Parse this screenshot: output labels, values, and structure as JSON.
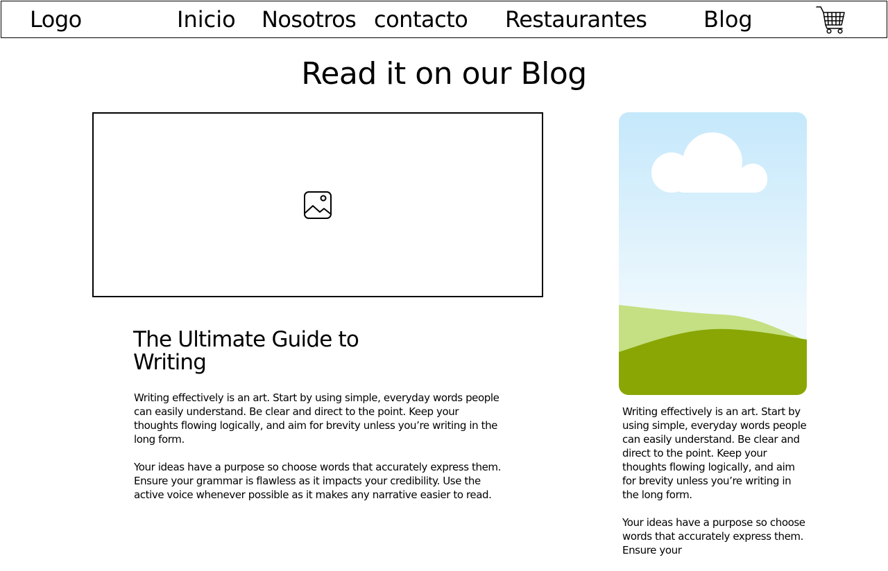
{
  "nav": {
    "logo": "Logo",
    "items": [
      {
        "label": "Inicio"
      },
      {
        "label": "Nosotros"
      },
      {
        "label": "contacto"
      },
      {
        "label": "Restaurantes"
      },
      {
        "label": "Blog"
      }
    ],
    "cart_icon": "shopping-cart-icon"
  },
  "page": {
    "heading": "Read it on our Blog"
  },
  "featured": {
    "image_icon": "image-placeholder-icon",
    "title": "The Ultimate Guide to Writing",
    "paragraphs": [
      "Writing effectively is an art. Start by using simple, everyday words people can easily understand. Be clear and direct to the point. Keep your thoughts flowing logically, and aim for brevity unless you’re writing in the long form.",
      "Your ideas have a purpose so choose words that accurately express them. Ensure your grammar is flawless as it impacts your credibility. Use the active voice whenever possible as it makes any narrative easier to read."
    ]
  },
  "side": {
    "image_icon": "landscape-illustration",
    "paragraphs": [
      "Writing effectively is an art. Start by using simple, everyday words people can easily understand. Be clear and direct to the point. Keep your thoughts flowing logically, and aim for brevity unless you’re writing in the long form.",
      "Your ideas have a purpose so choose words that accurately express them. Ensure your"
    ]
  },
  "colors": {
    "sky_top": "#c5e8fb",
    "sky_bottom": "#eef8fd",
    "hill_back": "#c4e082",
    "hill_front": "#8aa604",
    "border": "#000000"
  }
}
